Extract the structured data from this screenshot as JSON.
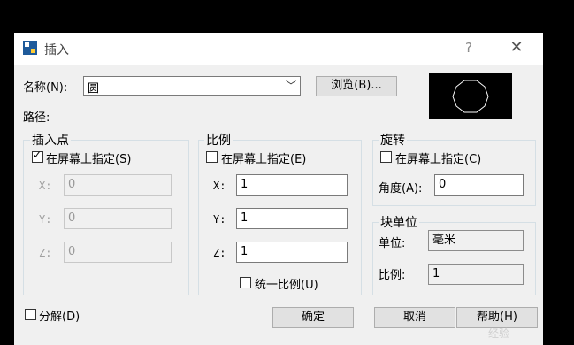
{
  "title": "插入",
  "titlebar": {
    "help": "?",
    "close": "✕"
  },
  "name": {
    "label": "名称(N):",
    "value": "圆",
    "browse": "浏览(B)..."
  },
  "path": {
    "label": "路径:"
  },
  "insert_point": {
    "title": "插入点",
    "specify_label": "在屏幕上指定(S)",
    "specify_checked": true,
    "x_label": "X:",
    "x_value": "0",
    "y_label": "Y:",
    "y_value": "0",
    "z_label": "Z:",
    "z_value": "0"
  },
  "scale": {
    "title": "比例",
    "specify_label": "在屏幕上指定(E)",
    "specify_checked": false,
    "x_label": "X:",
    "x_value": "1",
    "y_label": "Y:",
    "y_value": "1",
    "z_label": "Z:",
    "z_value": "1",
    "uniform_label": "统一比例(U)",
    "uniform_checked": false
  },
  "rotation": {
    "title": "旋转",
    "specify_label": "在屏幕上指定(C)",
    "specify_checked": false,
    "angle_label": "角度(A):",
    "angle_value": "0"
  },
  "block_unit": {
    "title": "块单位",
    "unit_label": "单位:",
    "unit_value": "毫米",
    "factor_label": "比例:",
    "factor_value": "1"
  },
  "explode": {
    "label": "分解(D)",
    "checked": false
  },
  "buttons": {
    "ok": "确定",
    "cancel": "取消",
    "help": "帮助(H)"
  },
  "watermark": "经验",
  "colors": {
    "dialog_bg": "#f0f0f0",
    "preview_bg": "#000000",
    "group_border": "#d5dfe5"
  },
  "icons": {
    "app": "autocad-insert-icon",
    "preview": "circle-block-preview"
  }
}
